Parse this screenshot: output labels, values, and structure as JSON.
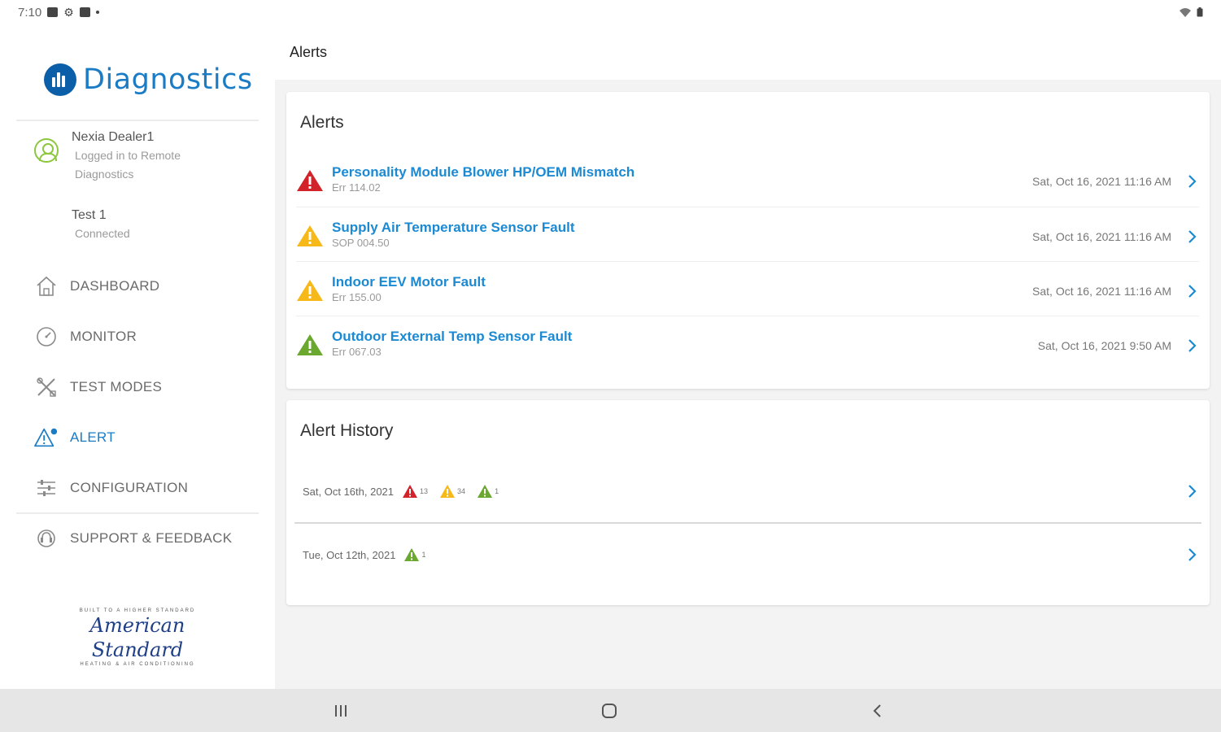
{
  "status_bar": {
    "time": "7:10"
  },
  "sidebar": {
    "logo_text": "Diagnostics",
    "account": {
      "dealer": "Nexia Dealer1",
      "dealer_status_line1": "Logged in to Remote",
      "dealer_status_line2": "Diagnostics",
      "device": "Test 1",
      "device_status": "Connected"
    },
    "nav": [
      {
        "label": "DASHBOARD",
        "icon": "home-icon"
      },
      {
        "label": "MONITOR",
        "icon": "gauge-icon"
      },
      {
        "label": "TEST MODES",
        "icon": "tools-icon"
      },
      {
        "label": "ALERT",
        "icon": "alert-icon",
        "active": true
      },
      {
        "label": "CONFIGURATION",
        "icon": "sliders-icon"
      },
      {
        "label": "SUPPORT & FEEDBACK",
        "icon": "support-icon"
      }
    ],
    "brand": {
      "top": "BUILT TO A HIGHER STANDARD",
      "name": "American Standard",
      "bottom": "HEATING & AIR CONDITIONING"
    }
  },
  "header": {
    "title": "Alerts"
  },
  "alerts_card": {
    "title": "Alerts",
    "items": [
      {
        "title": "Personality Module Blower HP/OEM Mismatch",
        "code": "Err 114.02",
        "time": "Sat, Oct 16, 2021  11:16 AM",
        "severity": "critical"
      },
      {
        "title": "Supply Air Temperature Sensor Fault",
        "code": "SOP 004.50",
        "time": "Sat, Oct 16, 2021  11:16 AM",
        "severity": "major"
      },
      {
        "title": "Indoor EEV Motor Fault",
        "code": "Err 155.00",
        "time": "Sat, Oct 16, 2021  11:16 AM",
        "severity": "major"
      },
      {
        "title": "Outdoor External Temp Sensor Fault",
        "code": "Err 067.03",
        "time": "Sat, Oct 16, 2021  9:50 AM",
        "severity": "minor"
      }
    ]
  },
  "history_card": {
    "title": "Alert History",
    "rows": [
      {
        "date": "Sat, Oct 16th, 2021",
        "counts": {
          "critical": "13",
          "major": "34",
          "minor": "1"
        }
      },
      {
        "date": "Tue, Oct 12th, 2021",
        "counts": {
          "minor": "1"
        }
      }
    ]
  },
  "colors": {
    "critical": "#d2232a",
    "major": "#f7b91a",
    "minor": "#6aa82f",
    "accent": "#1b8ad3"
  }
}
